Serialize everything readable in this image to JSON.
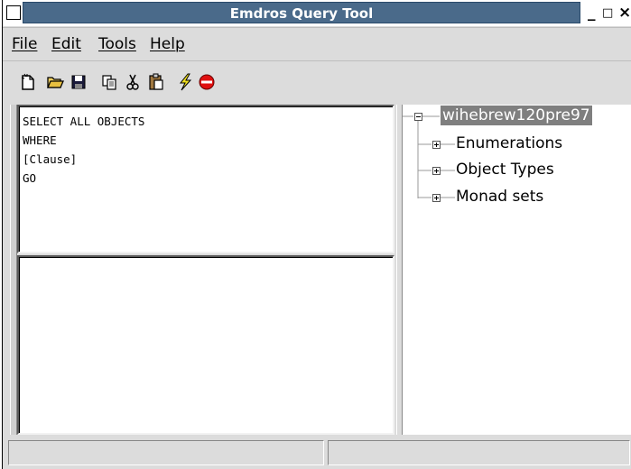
{
  "window": {
    "title": "Emdros Query Tool",
    "minimize_glyph": "_",
    "maximize_glyph": "□",
    "close_glyph": "×"
  },
  "menu": {
    "items": [
      {
        "label": "File"
      },
      {
        "label": "Edit"
      },
      {
        "label": "Tools"
      },
      {
        "label": "Help"
      }
    ]
  },
  "toolbar": {
    "buttons": [
      {
        "icon": "new-file-icon"
      },
      {
        "icon": "open-folder-icon"
      },
      {
        "icon": "save-disk-icon"
      },
      {
        "icon": "copy-icon"
      },
      {
        "icon": "cut-scissors-icon"
      },
      {
        "icon": "paste-clipboard-icon"
      },
      {
        "icon": "execute-lightning-icon"
      },
      {
        "icon": "stop-icon"
      }
    ]
  },
  "editor": {
    "text": "SELECT ALL OBJECTS\nWHERE\n[Clause]\nGO"
  },
  "results": {
    "text": ""
  },
  "tree": {
    "root": "wihebrew120pre97",
    "children": [
      {
        "label": "Enumerations"
      },
      {
        "label": "Object Types"
      },
      {
        "label": "Monad sets"
      }
    ]
  },
  "status": {
    "left": "",
    "right": ""
  },
  "colors": {
    "titlebar": "#4a6a8a",
    "selection": "#7f7f7f",
    "stop": "#e01010",
    "lightning": "#f0e020"
  }
}
